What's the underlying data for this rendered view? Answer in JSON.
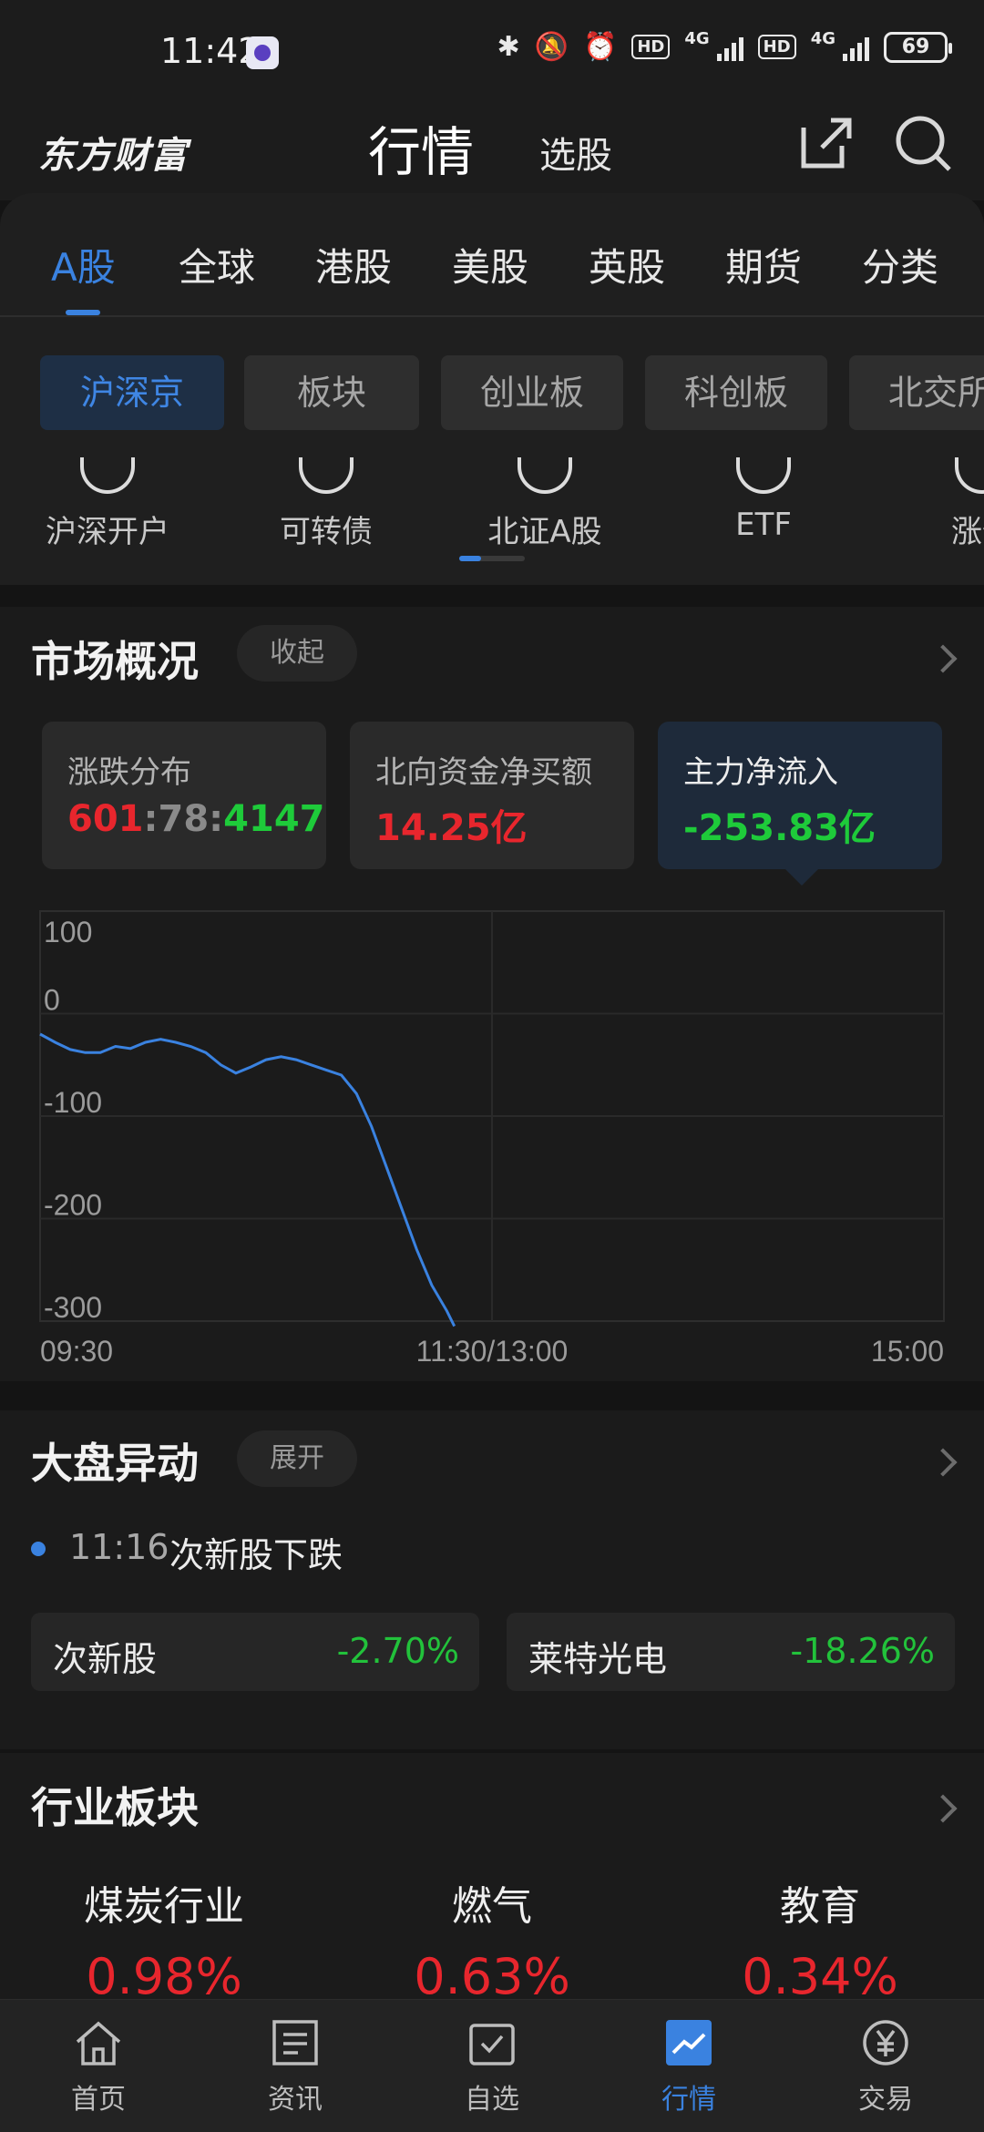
{
  "status": {
    "time": "11:42",
    "hd1": "HD",
    "net1": "4G",
    "hd2": "HD",
    "net2": "4G",
    "battery": "69"
  },
  "header": {
    "logo": "东方财富",
    "main_tab": "行情",
    "sub_tab": "选股"
  },
  "market_tabs": [
    "A股",
    "全球",
    "港股",
    "美股",
    "英股",
    "期货",
    "分类"
  ],
  "chips": [
    "沪深京",
    "板块",
    "创业板",
    "科创板",
    "北交所"
  ],
  "shortcuts": [
    "沪深开户",
    "可转债",
    "北证A股",
    "ETF",
    "涨停"
  ],
  "overview": {
    "title": "市场概况",
    "toggle": "收起",
    "cards": [
      {
        "label": "涨跌分布",
        "up": "601",
        "flat": "78",
        "down": "4147",
        "sep": ":"
      },
      {
        "label": "北向资金净买额",
        "value": "14.25亿"
      },
      {
        "label": "主力净流入",
        "value": "-253.83亿"
      }
    ]
  },
  "chart_data": {
    "type": "line",
    "series": [
      {
        "values": [
          [
            0,
            -20
          ],
          [
            4,
            -28
          ],
          [
            8,
            -35
          ],
          [
            12,
            -38
          ],
          [
            16,
            -38
          ],
          [
            20,
            -32
          ],
          [
            24,
            -34
          ],
          [
            28,
            -28
          ],
          [
            32,
            -25
          ],
          [
            36,
            -28
          ],
          [
            40,
            -32
          ],
          [
            44,
            -38
          ],
          [
            48,
            -50
          ],
          [
            52,
            -58
          ],
          [
            56,
            -52
          ],
          [
            60,
            -45
          ],
          [
            64,
            -42
          ],
          [
            68,
            -45
          ],
          [
            72,
            -50
          ],
          [
            76,
            -55
          ],
          [
            80,
            -60
          ],
          [
            84,
            -78
          ],
          [
            88,
            -110
          ],
          [
            92,
            -150
          ],
          [
            96,
            -190
          ],
          [
            100,
            -230
          ],
          [
            104,
            -265
          ],
          [
            108,
            -290
          ],
          [
            110,
            -305
          ]
        ]
      }
    ],
    "x_unit": "minutes since 09:30",
    "xlim": [
      0,
      240
    ],
    "ylim": [
      -300,
      100
    ],
    "yticks": [
      "100",
      "0",
      "-100",
      "-200",
      "-300"
    ],
    "xticks": [
      "09:30",
      "11:30/13:00",
      "15:00"
    ],
    "line_color": "#3a82e0"
  },
  "alerts": {
    "title": "大盘异动",
    "toggle": "展开",
    "time": "11:16",
    "text": "次新股下跌",
    "stocks": [
      {
        "name": "次新股",
        "pct": "-2.70%"
      },
      {
        "name": "莱特光电",
        "pct": "-18.26%"
      }
    ]
  },
  "industry": {
    "title": "行业板块",
    "items": [
      {
        "name": "煤炭行业",
        "pct": "0.98%"
      },
      {
        "name": "燃气",
        "pct": "0.63%"
      },
      {
        "name": "教育",
        "pct": "0.34%"
      }
    ]
  },
  "bottom_nav": [
    "首页",
    "资讯",
    "自选",
    "行情",
    "交易"
  ]
}
